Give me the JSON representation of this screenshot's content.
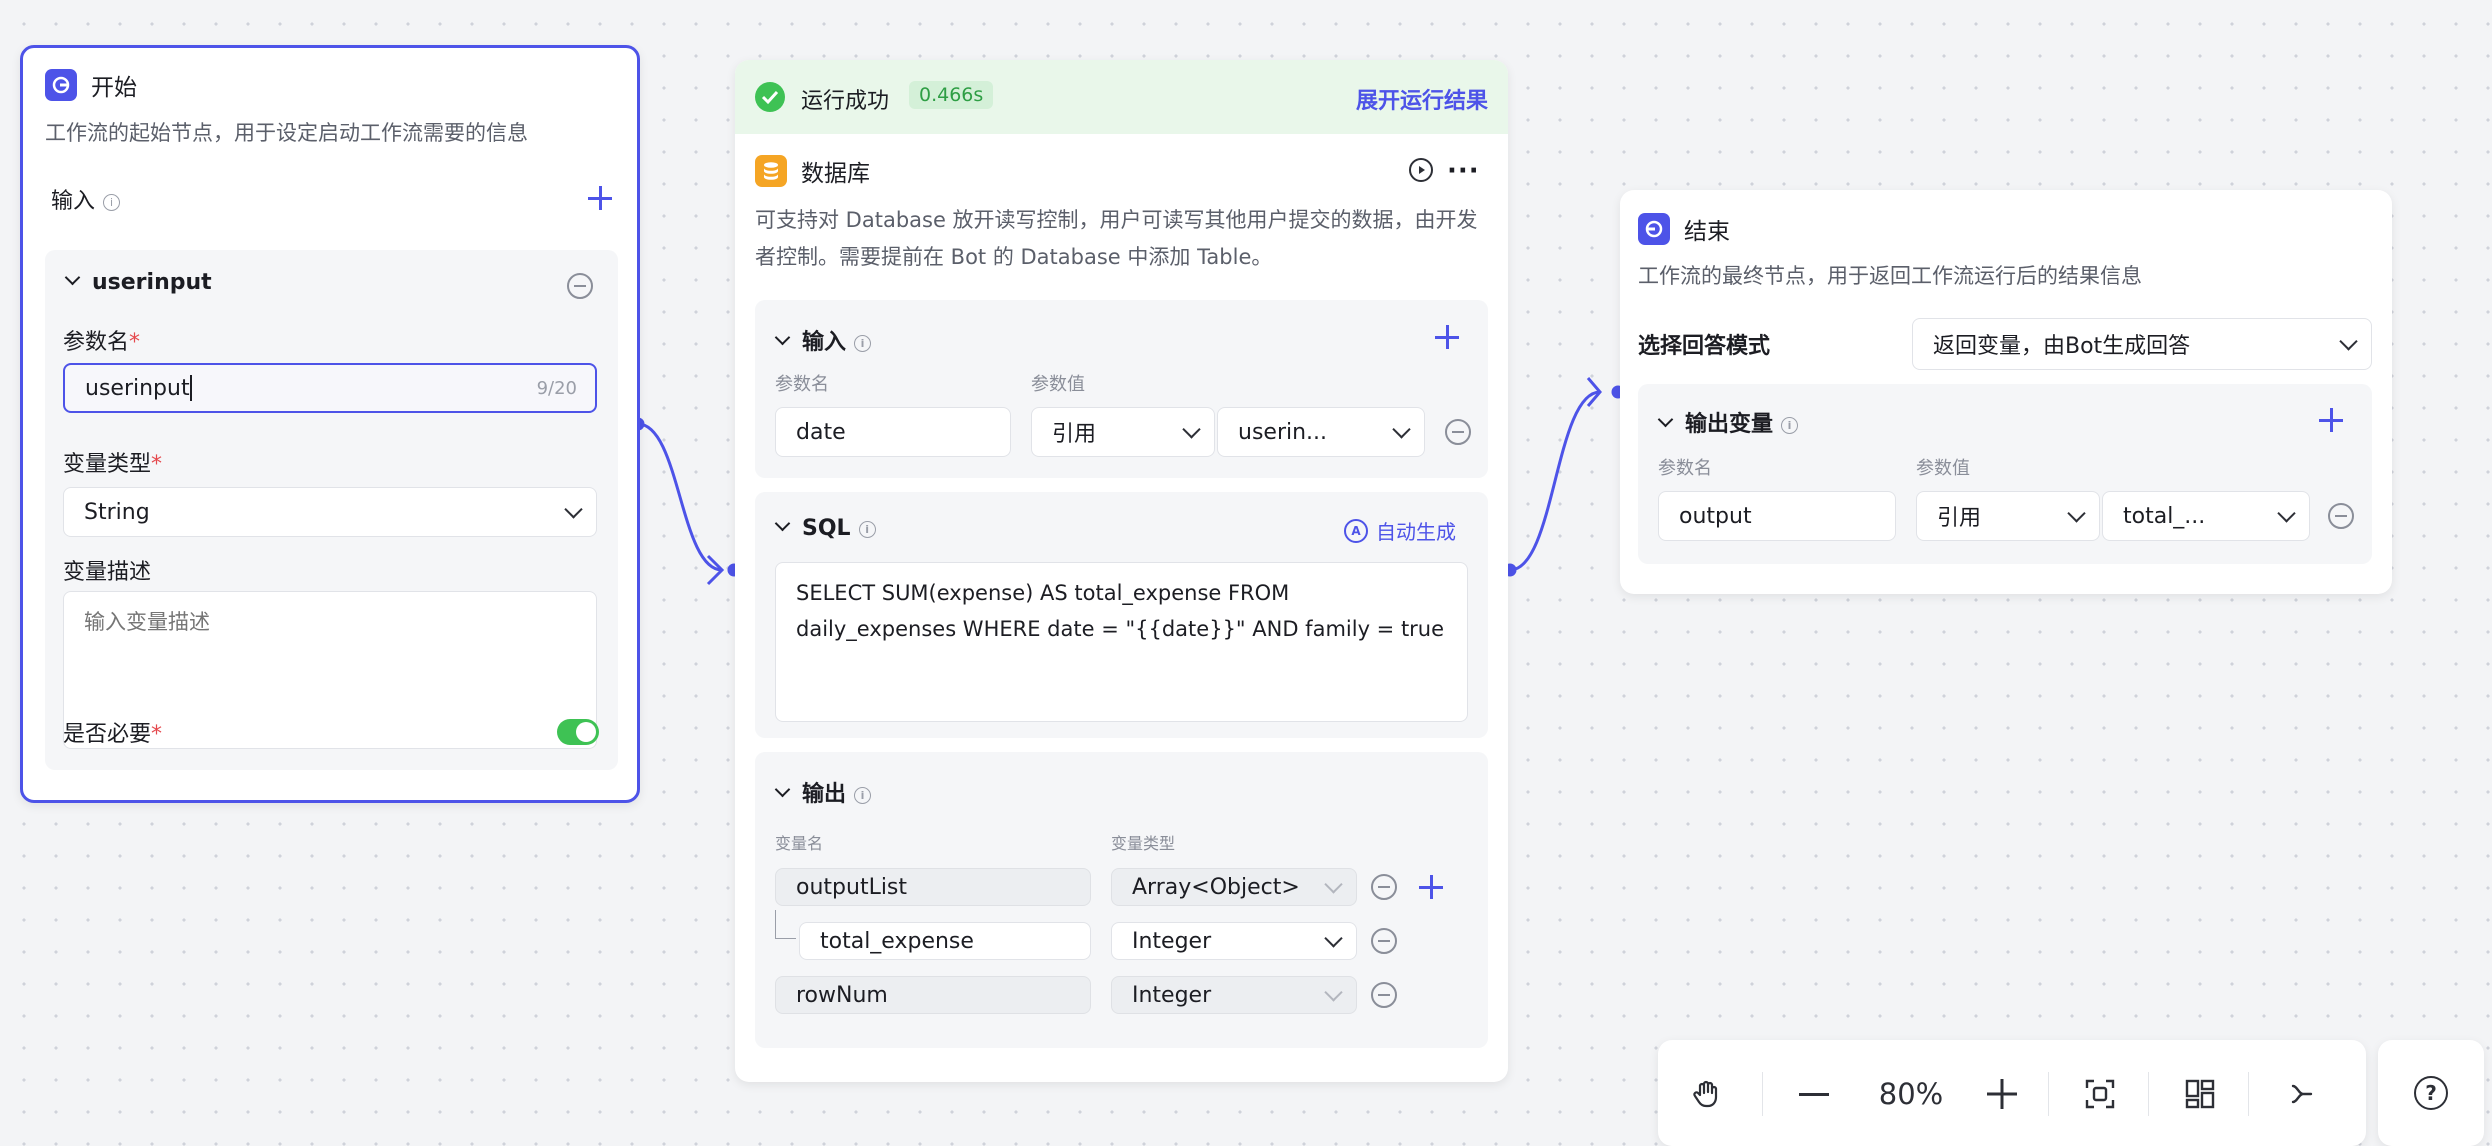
{
  "start_node": {
    "title": "开始",
    "description": "工作流的起始节点，用于设定启动工作流需要的信息",
    "input_label": "输入",
    "param": {
      "name": "userinput",
      "param_name_label": "参数名",
      "param_name_value": "userinput",
      "param_name_count": "9/20",
      "type_label": "变量类型",
      "type_value": "String",
      "desc_label": "变量描述",
      "desc_placeholder": "输入变量描述",
      "required_label": "是否必要",
      "required": true
    }
  },
  "db_node": {
    "status": "运行成功",
    "duration": "0.466s",
    "expand_link": "展开运行结果",
    "title": "数据库",
    "description": "可支持对 Database 放开读写控制，用户可读写其他用户提交的数据，由开发者控制。需要提前在 Bot 的 Database 中添加 Table。",
    "input": {
      "label": "输入",
      "col_name": "参数名",
      "col_value": "参数值",
      "name": "date",
      "ref_type": "引用",
      "ref_value": "userin..."
    },
    "sql": {
      "label": "SQL",
      "auto_gen": "自动生成",
      "text": "SELECT SUM(expense) AS total_expense FROM daily_expenses WHERE date = \"{{date}}\" AND family = true"
    },
    "output": {
      "label": "输出",
      "col_name": "变量名",
      "col_type": "变量类型",
      "rows": [
        {
          "name": "outputList",
          "type": "Array<Object>"
        },
        {
          "name": "total_expense",
          "type": "Integer"
        },
        {
          "name": "rowNum",
          "type": "Integer"
        }
      ]
    }
  },
  "end_node": {
    "title": "结束",
    "description": "工作流的最终节点，用于返回工作流运行后的结果信息",
    "mode_label": "选择回答模式",
    "mode_value": "返回变量，由Bot生成回答",
    "output": {
      "label": "输出变量",
      "col_name": "参数名",
      "col_value": "参数值",
      "name": "output",
      "ref_type": "引用",
      "ref_value": "total_..."
    }
  },
  "toolbar": {
    "zoom": "80%",
    "icons": [
      "hand-icon",
      "zoom-out-icon",
      "zoom-in-icon",
      "fit-view-icon",
      "layout-icon",
      "connector-icon",
      "help-icon"
    ]
  },
  "colors": {
    "accent": "#4d53e8",
    "success": "#3ec254",
    "db": "#f5a524"
  }
}
